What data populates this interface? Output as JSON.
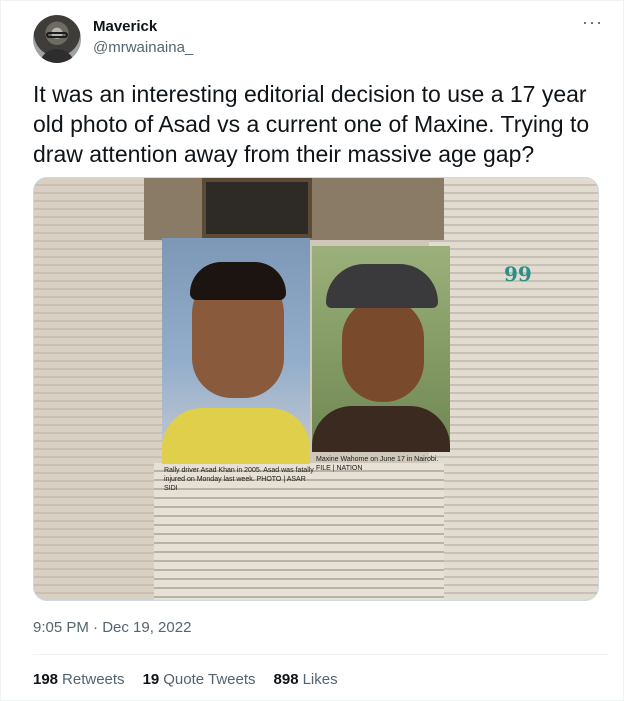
{
  "author": {
    "display_name": "Maverick",
    "handle": "@mrwainaina_"
  },
  "menu_icon": "more-horizontal-icon",
  "tweet": {
    "text": "It was an interesting editorial decision to use a 17 year old photo of Asad vs a current one of Maxine. Trying to draw attention away from their massive age gap?"
  },
  "media": {
    "caption_asad": "Rally driver Asad Khan in 2005. Asad was fatally injured on Monday last week. PHOTO | ASAR SIDI",
    "caption_maxine": "Maxine Wahome on June 17 in Nairobi. FILE | NATION"
  },
  "meta": {
    "timestamp": "9:05 PM · Dec 19, 2022"
  },
  "stats": {
    "retweets_count": "198",
    "retweets_label": "Retweets",
    "quotes_count": "19",
    "quotes_label": "Quote Tweets",
    "likes_count": "898",
    "likes_label": "Likes"
  }
}
